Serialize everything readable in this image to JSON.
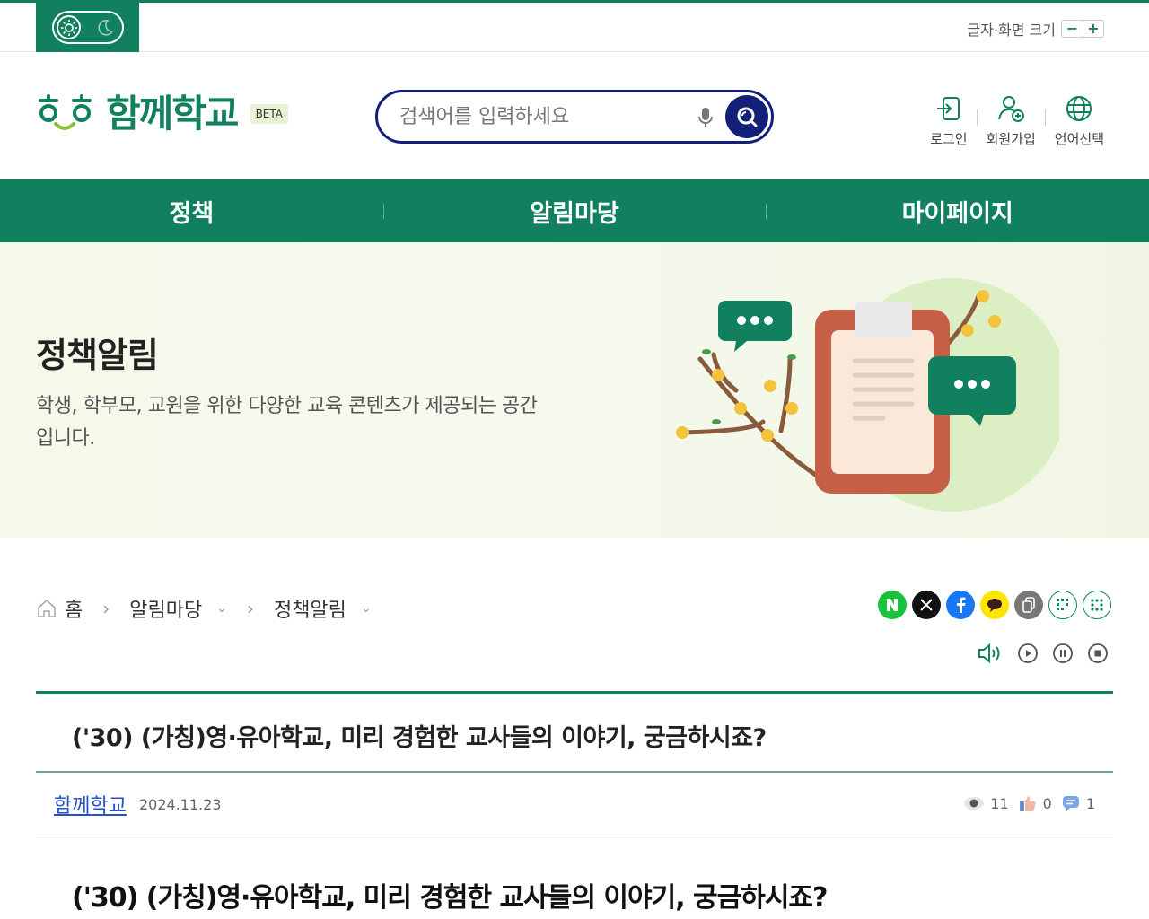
{
  "utility": {
    "font_size_label": "글자·화면 크기",
    "decrease": "−",
    "increase": "+"
  },
  "header": {
    "logo_text": "함께학교",
    "beta": "BETA",
    "search_placeholder": "검색어를 입력하세요",
    "links": [
      {
        "label": "로그인",
        "icon": "login-icon"
      },
      {
        "label": "회원가입",
        "icon": "user-add-icon"
      },
      {
        "label": "언어선택",
        "icon": "globe-icon"
      }
    ]
  },
  "gnb": [
    "정책",
    "알림마당",
    "마이페이지"
  ],
  "hero": {
    "title": "정책알림",
    "desc": "학생, 학부모, 교원을 위한 다양한 교육 콘텐츠가 제공되는 공간입니다."
  },
  "breadcrumb": {
    "home": "홈",
    "level1": "알림마당",
    "level2": "정책알림"
  },
  "article": {
    "title": "('30) (가칭)영·유아학교, 미리 경험한 교사들의 이야기, 궁금하시죠?",
    "author": "함께학교",
    "date": "2024.11.23",
    "views": "11",
    "likes": "0",
    "comments": "1",
    "body_title": "('30) (가칭)영·유아학교, 미리 경험한 교사들의 이야기, 궁금하시죠?"
  },
  "colors": {
    "brand_green": "#11805f",
    "search_navy": "#13207a"
  }
}
